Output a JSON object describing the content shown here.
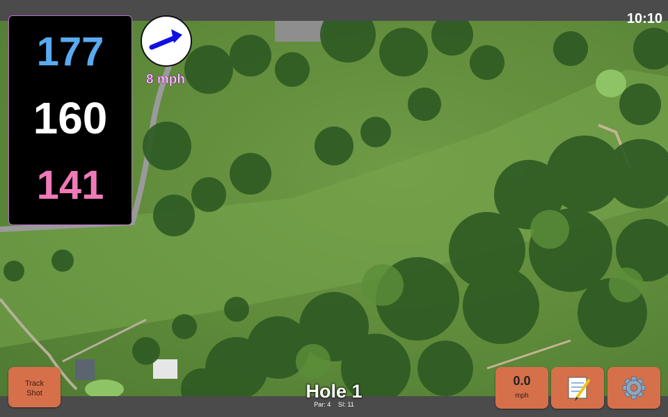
{
  "status_bar": {
    "clock": "10:10"
  },
  "distances": {
    "back": "177",
    "middle": "160",
    "front": "141"
  },
  "wind": {
    "speed": "8 mph",
    "direction_icon": "arrow-icon",
    "arrow_color": "#1010e0"
  },
  "hole": {
    "title": "Hole 1",
    "par": "Par: 4",
    "stroke_index": "SI: 11"
  },
  "buttons": {
    "track_shot": {
      "line1": "Track",
      "line2": "Shot"
    },
    "speed": {
      "value": "0.0",
      "unit": "mph"
    },
    "notes": {
      "icon": "notepad-icon"
    },
    "settings": {
      "icon": "gear-icon"
    }
  },
  "colors": {
    "back": "#5aaaf0",
    "middle": "#ffffff",
    "front": "#f07ab8",
    "button": "#d6704a"
  }
}
